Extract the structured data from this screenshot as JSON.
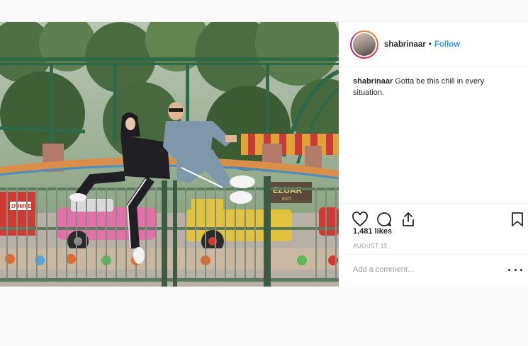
{
  "post": {
    "username": "shabrinaar",
    "separator": "•",
    "follow_label": "Follow",
    "caption_username": "shabrinaar",
    "caption_text": " Gotta be this chill in every situation.",
    "likes": "1,481 likes",
    "date": "AUGUST 15",
    "comment_placeholder": "Add a comment...",
    "sign_text": "ELUAR",
    "sign_subtext": "EXIT",
    "truck_label": "DUMPER"
  },
  "colors": {
    "link": "#3897f0",
    "text": "#262626",
    "muted": "#999999",
    "border": "#efefef"
  },
  "icons": [
    "heart-icon",
    "comment-icon",
    "share-icon",
    "bookmark-icon",
    "more-icon"
  ]
}
